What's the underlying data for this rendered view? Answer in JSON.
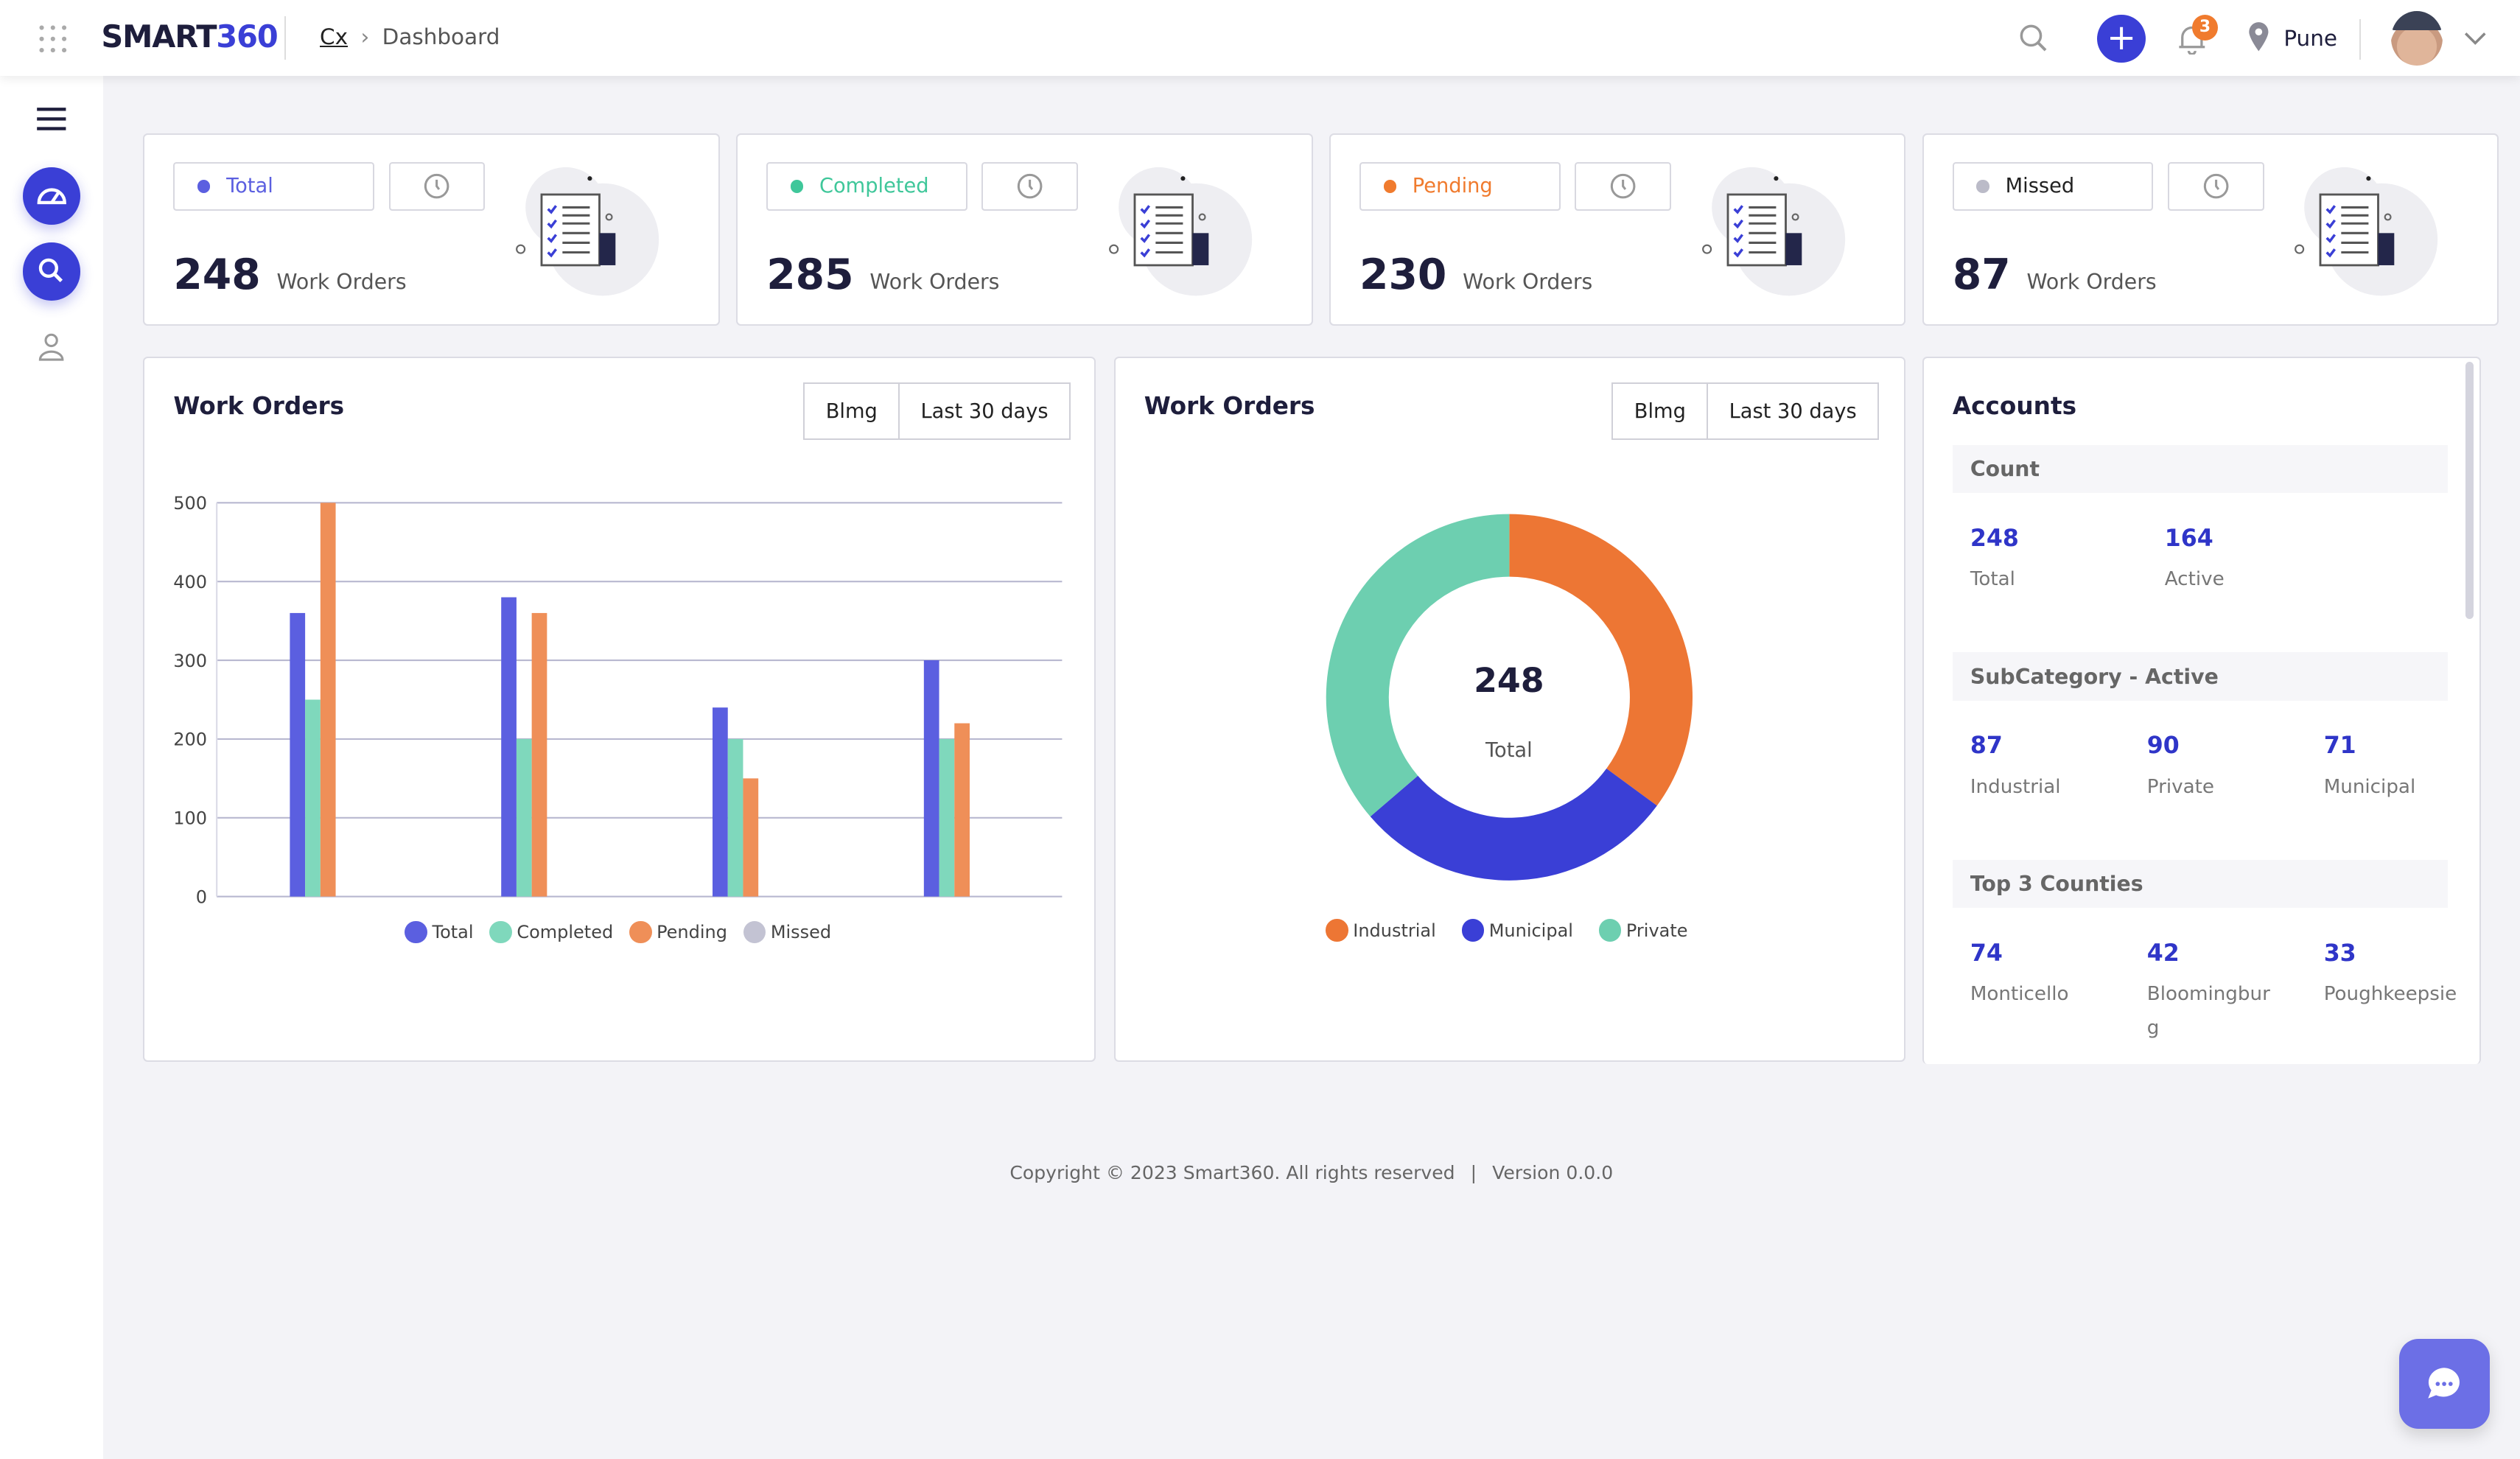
{
  "header": {
    "brand_part1": "SMART",
    "brand_part2": "360",
    "breadcrumb": [
      "Cx",
      "Dashboard"
    ],
    "notifications_count": "3",
    "location": "Pune"
  },
  "stats": [
    {
      "label": "Total",
      "value": "248",
      "unit": "Work Orders",
      "color": "#5b5fe0"
    },
    {
      "label": "Completed",
      "value": "285",
      "unit": "Work Orders",
      "color": "#3fc79a"
    },
    {
      "label": "Pending",
      "value": "230",
      "unit": "Work Orders",
      "color": "#f07b2e"
    },
    {
      "label": "Missed",
      "value": "87",
      "unit": "Work Orders",
      "color": "#bbbbc8"
    }
  ],
  "bar_panel": {
    "title": "Work Orders",
    "filter1": "Blmg",
    "filter2": "Last 30 days"
  },
  "donut_panel": {
    "title": "Work Orders",
    "filter1": "Blmg",
    "filter2": "Last 30 days",
    "center_value": "248",
    "center_label": "Total"
  },
  "chart_data": [
    {
      "type": "bar",
      "ylim": [
        0,
        500
      ],
      "yticks": [
        "0",
        "100",
        "200",
        "300",
        "400",
        "500"
      ],
      "grid": true,
      "legend": "bottom",
      "categories": [
        "",
        "",
        "",
        ""
      ],
      "series": [
        {
          "name": "Total",
          "color": "#5b5fe0",
          "values": [
            360,
            380,
            240,
            300
          ]
        },
        {
          "name": "Completed",
          "color": "#7fd8bc",
          "values": [
            250,
            200,
            200,
            200
          ]
        },
        {
          "name": "Pending",
          "color": "#ef8f58",
          "values": [
            500,
            360,
            150,
            220
          ]
        },
        {
          "name": "Missed",
          "color": "#c3c3d3",
          "values": [
            0,
            0,
            0,
            0
          ]
        }
      ]
    },
    {
      "type": "pie",
      "legend": "bottom",
      "slices": [
        {
          "name": "Industrial",
          "value": 87,
          "color": "#ed7634"
        },
        {
          "name": "Municipal",
          "value": 71,
          "color": "#3a3fd6"
        },
        {
          "name": "Private",
          "value": 90,
          "color": "#6dcfb0"
        }
      ]
    }
  ],
  "accounts": {
    "title": "Accounts",
    "count": {
      "title": "Count",
      "items": [
        {
          "value": "248",
          "label": "Total"
        },
        {
          "value": "164",
          "label": "Active"
        }
      ]
    },
    "subcategory": {
      "title": "SubCategory - Active",
      "items": [
        {
          "value": "87",
          "label": "Industrial"
        },
        {
          "value": "90",
          "label": "Private"
        },
        {
          "value": "71",
          "label": "Municipal"
        }
      ]
    },
    "counties": {
      "title": "Top 3 Counties",
      "items": [
        {
          "value": "74",
          "label": "Monticello"
        },
        {
          "value": "42",
          "label": "Bloomingburg"
        },
        {
          "value": "33",
          "label": "Poughkeepsie"
        }
      ]
    }
  },
  "footer": {
    "copyright": "Copyright © 2023 Smart360. All rights reserved",
    "separator": "|",
    "version": "Version 0.0.0"
  }
}
